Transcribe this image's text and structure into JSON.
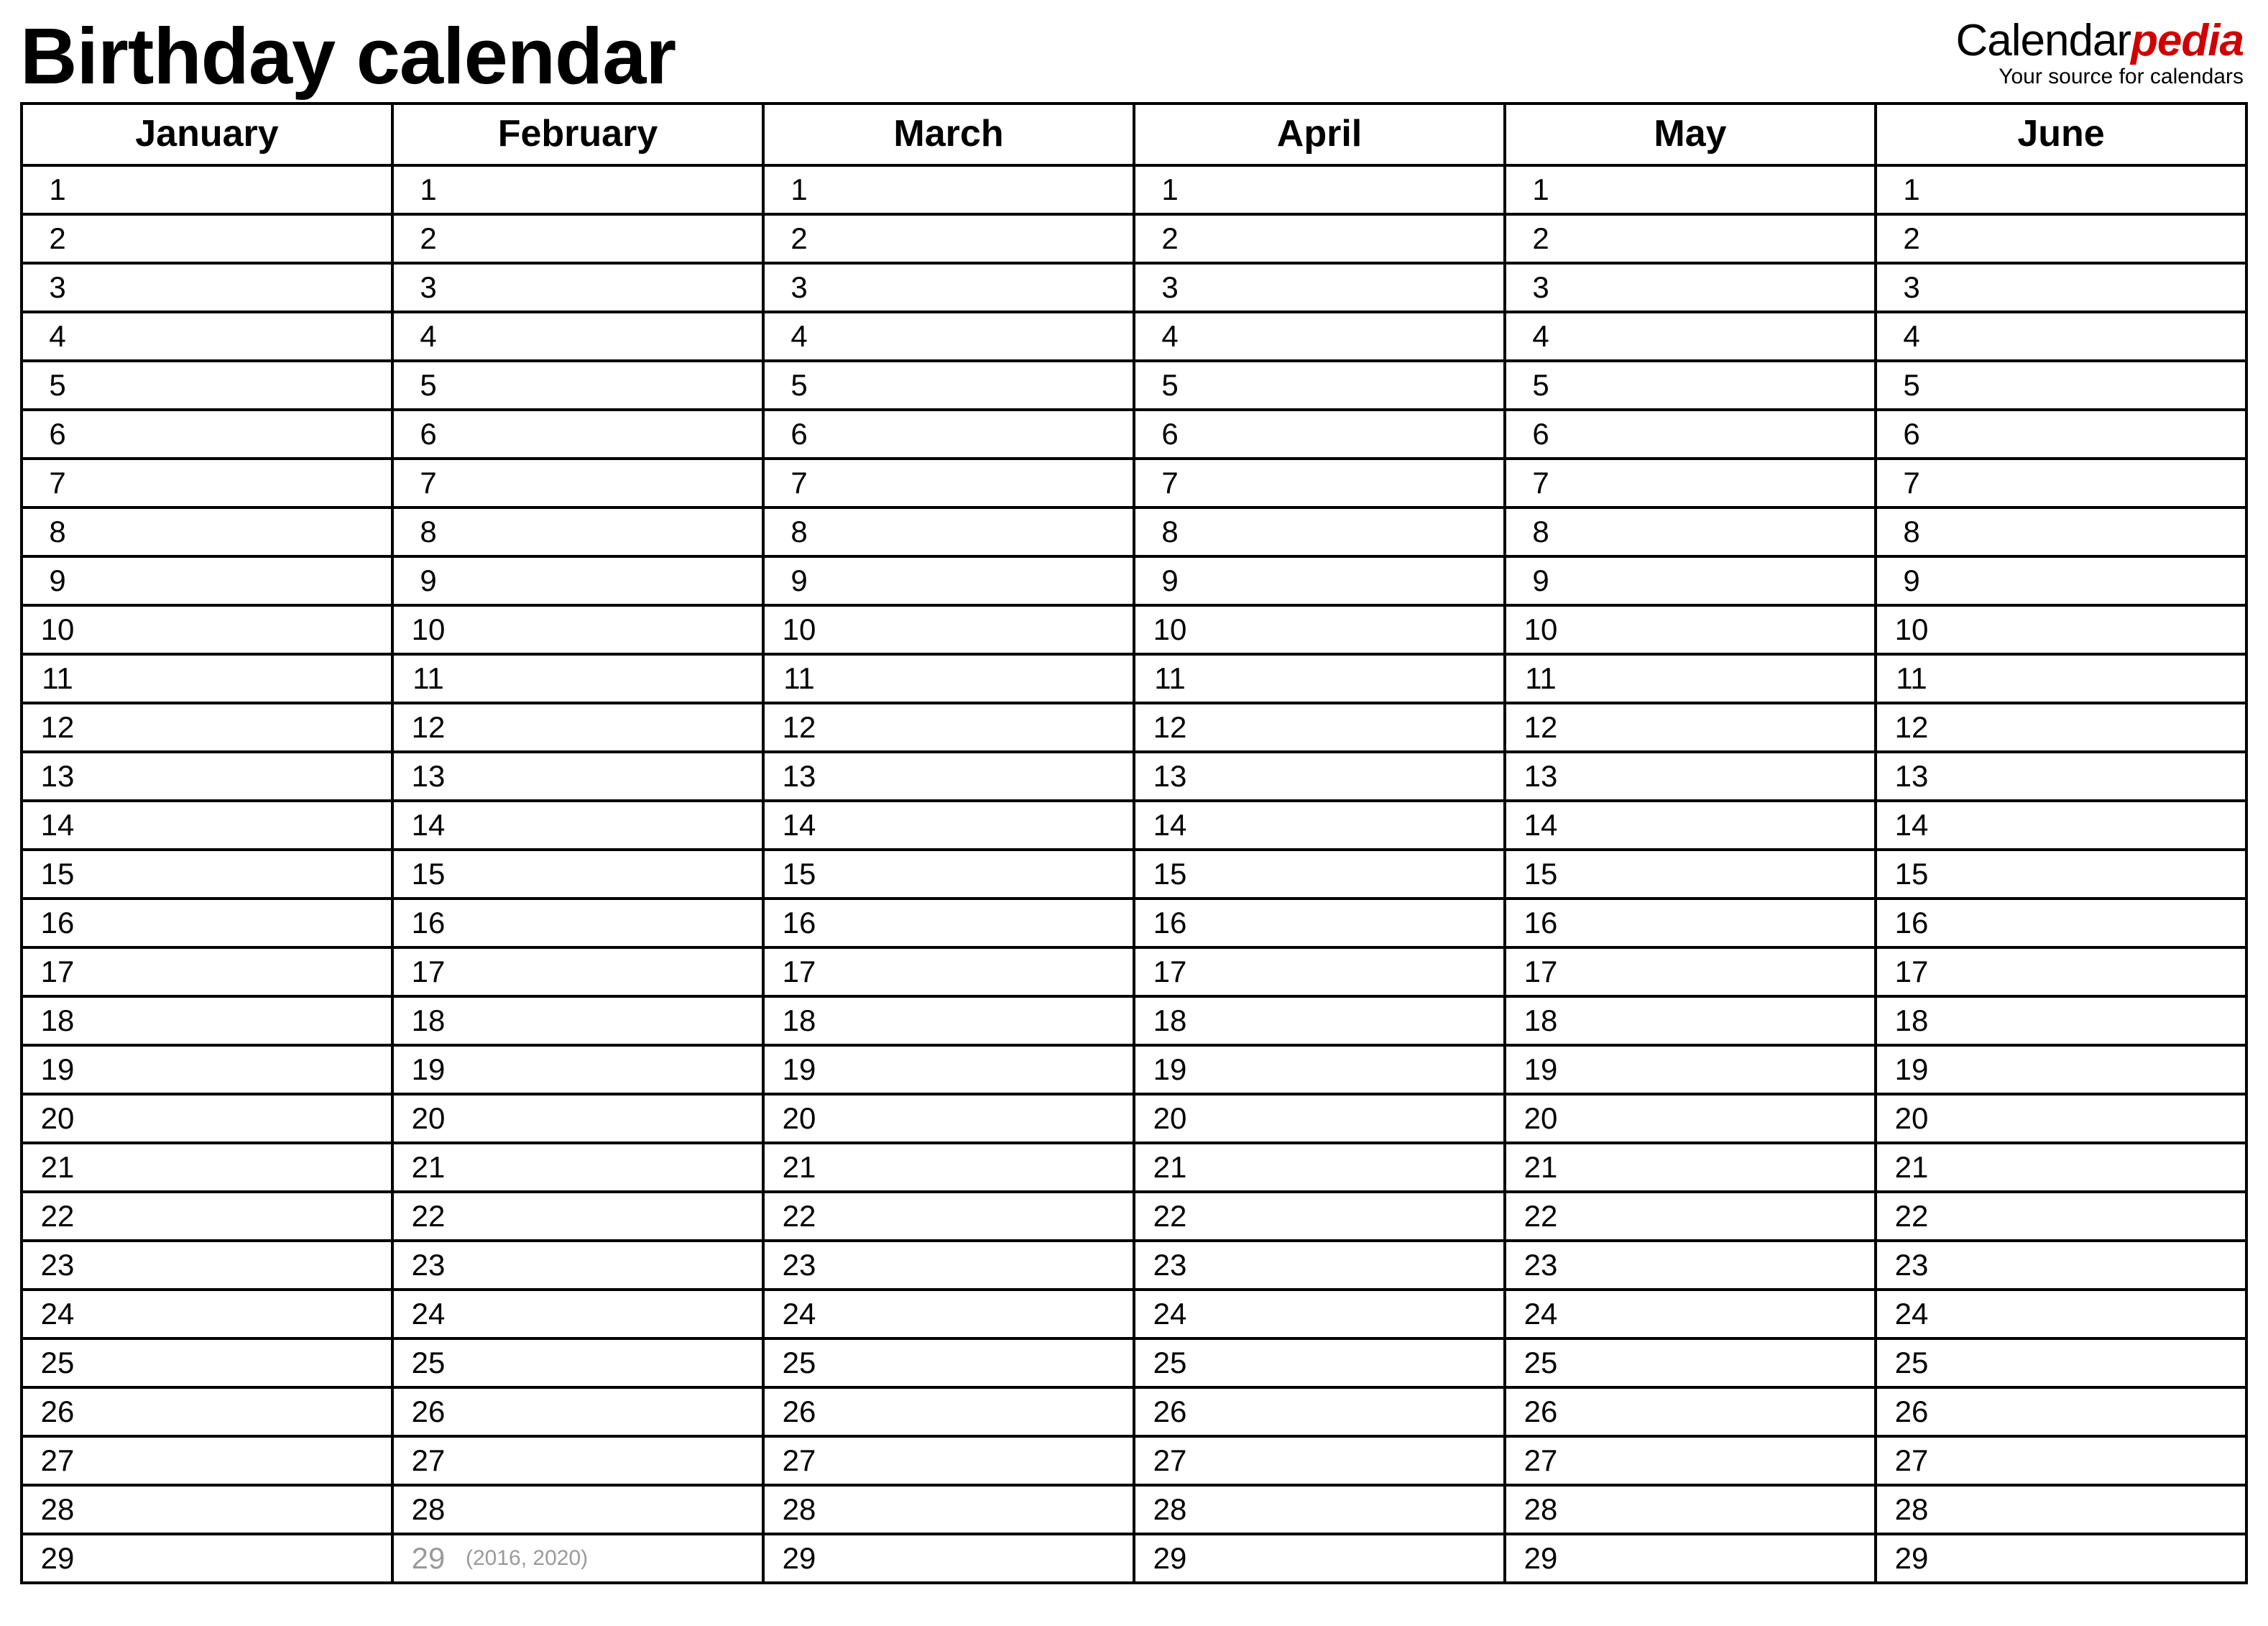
{
  "header": {
    "title": "Birthday calendar",
    "brand_prefix": "Calendar",
    "brand_suffix": "pedia",
    "brand_tagline": "Your source for calendars"
  },
  "months": [
    "January",
    "February",
    "March",
    "April",
    "May",
    "June"
  ],
  "max_day": 29,
  "feb29_note": "(2016, 2020)",
  "colors": {
    "accent": "#d10000",
    "grey": "#9a9a9a"
  }
}
